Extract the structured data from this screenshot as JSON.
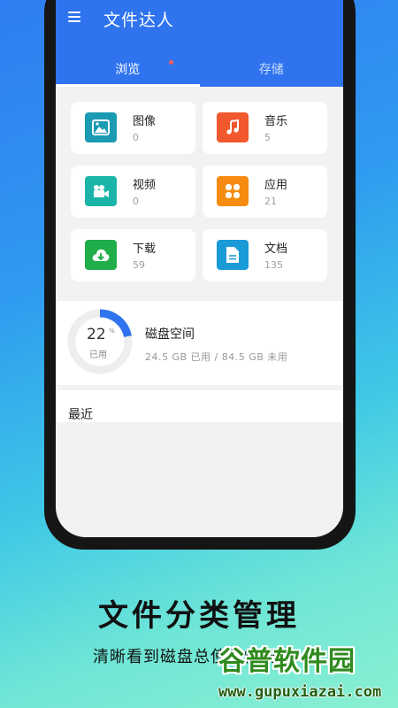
{
  "app": {
    "title": "文件达人"
  },
  "tabs": [
    {
      "label": "浏览",
      "active": true,
      "has_dot": true
    },
    {
      "label": "存储",
      "active": false
    }
  ],
  "categories": [
    {
      "label": "图像",
      "count": "0",
      "icon": "image-icon",
      "color": "#1a9bb3"
    },
    {
      "label": "音乐",
      "count": "5",
      "icon": "music-note-icon",
      "color": "#f2582e"
    },
    {
      "label": "视频",
      "count": "0",
      "icon": "video-camera-icon",
      "color": "#1ab5a8"
    },
    {
      "label": "应用",
      "count": "21",
      "icon": "apps-grid-icon",
      "color": "#f58b10"
    },
    {
      "label": "下载",
      "count": "59",
      "icon": "cloud-download-icon",
      "color": "#1fae4a"
    },
    {
      "label": "文档",
      "count": "135",
      "icon": "document-icon",
      "color": "#1a9ad6"
    }
  ],
  "storage": {
    "percent": "22",
    "percent_unit": "%",
    "used_label": "已用",
    "title": "磁盘空间",
    "detail": "24.5 GB 已用 / 84.5 GB 未用",
    "used_fraction": 0.22,
    "accent": "#2f73ef",
    "track": "#eeeeee"
  },
  "recent": {
    "title": "最近"
  },
  "promo": {
    "headline": "文件分类管理",
    "subline": "清晰看到磁盘总使用情况"
  },
  "watermark": {
    "cn": "谷普软件园",
    "en": "www.gupuxiazai.com"
  }
}
